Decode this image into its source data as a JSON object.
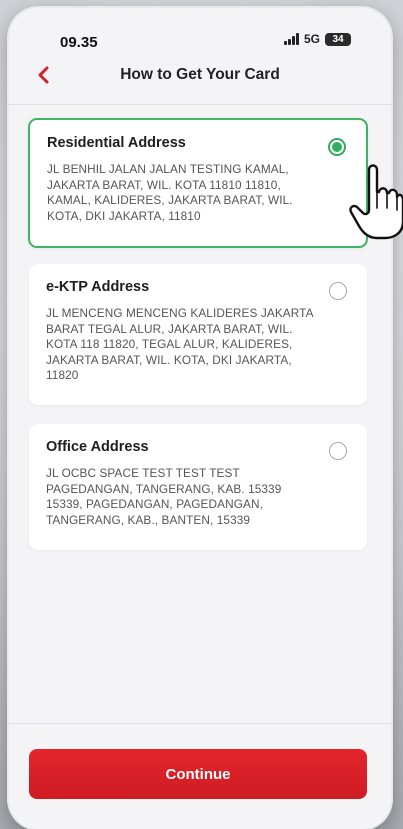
{
  "status_bar": {
    "time": "09.35",
    "network": "5G",
    "battery": "34"
  },
  "header": {
    "title": "How to Get Your Card",
    "back_icon": "chevron-left-icon"
  },
  "addresses": [
    {
      "title": "Residential Address",
      "body": "JL BENHIL JALAN JALAN TESTING KAMAL, JAKARTA BARAT, WIL. KOTA 11810 11810, KAMAL, KALIDERES, JAKARTA BARAT, WIL. KOTA, DKI JAKARTA, 11810",
      "selected": true
    },
    {
      "title": "e-KTP Address",
      "body": "JL MENCENG MENCENG KALIDERES JAKARTA BARAT TEGAL ALUR, JAKARTA BARAT, WIL. KOTA 118 11820, TEGAL ALUR, KALIDERES, JAKARTA BARAT, WIL. KOTA, DKI JAKARTA, 11820",
      "selected": false
    },
    {
      "title": "Office Address",
      "body": "JL OCBC SPACE TEST TEST TEST PAGEDANGAN, TANGERANG, KAB. 15339 15339, PAGEDANGAN, PAGEDANGAN, TANGERANG, KAB., BANTEN, 15339",
      "selected": false
    }
  ],
  "footer": {
    "continue_label": "Continue"
  },
  "colors": {
    "accent_red": "#d91f26",
    "selected_green": "#2fae5d"
  },
  "icons": {
    "pointer": "hand-pointer-icon"
  }
}
